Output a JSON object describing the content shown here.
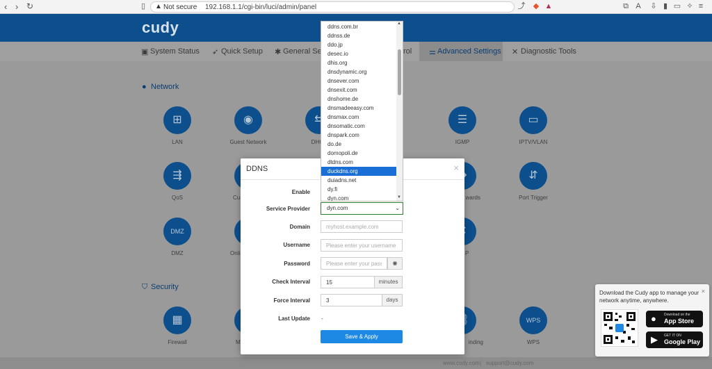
{
  "browser": {
    "security_label": "Not secure",
    "url": "192.168.1.1/cgi-bin/luci/admin/panel"
  },
  "brand": {
    "logo": "cudy"
  },
  "nav": [
    {
      "label": "System Status",
      "icon": "monitor-icon"
    },
    {
      "label": "Quick Setup",
      "icon": "rocket-icon"
    },
    {
      "label": "General Setti",
      "icon": "gear-icon"
    },
    {
      "label": "rol",
      "icon": ""
    },
    {
      "label": "Advanced Settings",
      "icon": "sliders-icon",
      "active": true
    },
    {
      "label": "Diagnostic Tools",
      "icon": "tools-icon"
    }
  ],
  "sections": {
    "network": "Network",
    "security": "Security"
  },
  "tiles": {
    "lan": "LAN",
    "guest_network": "Guest Network",
    "dhcp": "DHCP",
    "igmp": "IGMP",
    "iptv_vlan": "IPTV/VLAN",
    "qos": "QoS",
    "cu": "Cu",
    "forwards": "wards",
    "port_trigger": "Port Trigger",
    "dmz": "DMZ",
    "online": "Onli",
    "p": "P",
    "firewall": "Firewall",
    "m": "M",
    "binding": "inding",
    "wps": "WPS"
  },
  "modal": {
    "title": "DDNS",
    "labels": {
      "enable": "Enable",
      "service_provider": "Service Provider",
      "domain": "Domain",
      "username": "Username",
      "password": "Password",
      "check_interval": "Check Interval",
      "force_interval": "Force Interval",
      "last_update": "Last Update"
    },
    "service_provider_value": "dyn.com",
    "domain_placeholder": "myhost.example.com",
    "username_placeholder": "Please enter your username",
    "password_placeholder": "Please enter your passw",
    "check_interval_value": "15",
    "check_interval_unit": "minutes",
    "force_interval_value": "3",
    "force_interval_unit": "days",
    "last_update_value": "-",
    "save_button": "Save & Apply"
  },
  "dropdown": {
    "options": [
      "ddns.com.br",
      "ddnss.de",
      "ddo.jp",
      "desec.io",
      "dhis.org",
      "dnsdynamic.org",
      "dnsever.com",
      "dnsexit.com",
      "dnshome.de",
      "dnsmadeeasy.com",
      "dnsmax.com",
      "dnsomatic.com",
      "dnspark.com",
      "do.de",
      "domopoli.de",
      "dtdns.com",
      "duckdns.org",
      "duiadns.net",
      "dy.fi",
      "dyn.com"
    ],
    "highlighted": "duckdns.org"
  },
  "promo": {
    "text": "Download the Cudy app to manage your network anytime, anywhere.",
    "app_store_small": "Download on the",
    "app_store_big": "App Store",
    "google_play_small": "GET IT ON",
    "google_play_big": "Google Play"
  },
  "footer": {
    "website": "www.cudy.com",
    "support": "support@cudy.com"
  }
}
